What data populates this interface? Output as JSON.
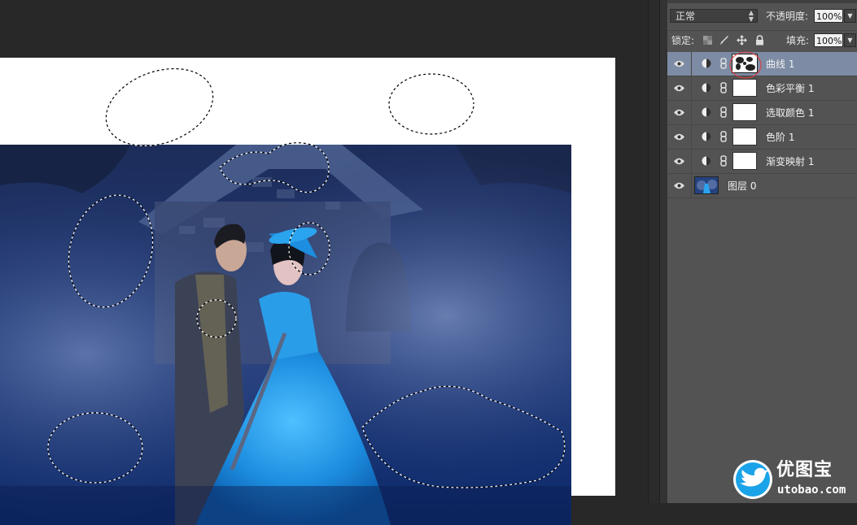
{
  "layers_panel": {
    "blend_mode": "正常",
    "opacity_label": "不透明度:",
    "opacity_value": "100%",
    "lock_label": "锁定:",
    "fill_label": "填充:",
    "fill_value": "100%",
    "layers": [
      {
        "name": "曲线 1",
        "type": "adjustment",
        "selected": true
      },
      {
        "name": "色彩平衡 1",
        "type": "adjustment",
        "selected": false
      },
      {
        "name": "选取颜色 1",
        "type": "adjustment",
        "selected": false
      },
      {
        "name": "色阶 1",
        "type": "adjustment",
        "selected": false
      },
      {
        "name": "渐变映射 1",
        "type": "adjustment",
        "selected": false
      },
      {
        "name": "图层 0",
        "type": "pixel",
        "selected": false
      }
    ]
  },
  "icons": {
    "visibility": "eye-icon",
    "adjustment": "adjustment-layer-icon",
    "link": "chain-link-icon",
    "lock_transparent": "lock-transparent-pixels-icon",
    "lock_image": "lock-image-pixels-icon",
    "lock_position": "lock-position-icon",
    "lock_all": "lock-all-icon",
    "dropdown": "chevron-down-icon"
  },
  "watermark": {
    "text": "优图宝",
    "url": "utobao.com"
  },
  "colors": {
    "selected_layer": "#7d8ca4",
    "panel_bg": "#535353",
    "workspace_bg": "#282828",
    "watermark_blue": "#1aa3e8"
  }
}
